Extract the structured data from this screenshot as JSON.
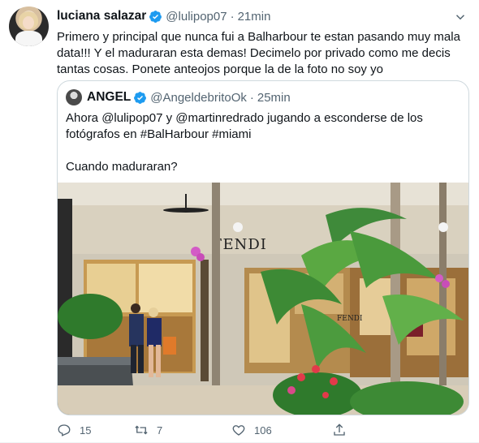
{
  "tweet": {
    "author_name": "luciana salazar",
    "author_handle": "@lulipop07",
    "separator": "·",
    "time": "21min",
    "text": "Primero y principal que nunca fui a Balharbour te estan pasando muy mala data!!! Y el maduraran esta demas! Decimelo por privado como me decis tantas cosas. Ponete anteojos porque la de la foto no soy yo"
  },
  "quoted": {
    "author_name": "ANGEL",
    "author_handle": "@AngeldebritoOk",
    "separator": "·",
    "time": "25min",
    "line1": "Ahora @lulipop07 y @martinredrado jugando a esconderse de los fotógrafos en #BalHarbour #miami",
    "line2": "Cuando maduraran?",
    "photo_sign": "FENDI"
  },
  "actions": {
    "replies": "15",
    "retweets": "7",
    "likes": "106"
  },
  "icons": {
    "verified": "verified-badge-icon",
    "more": "chevron-down-icon",
    "reply": "reply-icon",
    "retweet": "retweet-icon",
    "like": "heart-icon",
    "share": "share-icon"
  },
  "colors": {
    "verified": "#1d9bf0",
    "secondary_text": "#536471",
    "border": "#cfd9de"
  }
}
